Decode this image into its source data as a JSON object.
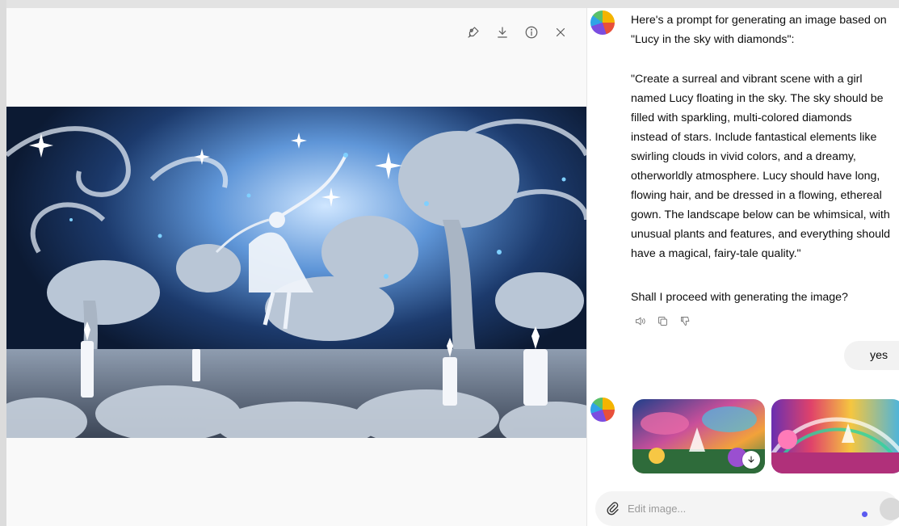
{
  "viewer": {
    "toolbar": {
      "edit_icon": "brush-icon",
      "download_icon": "download-icon",
      "info_icon": "info-icon",
      "close_icon": "close-icon"
    }
  },
  "chat": {
    "assistant_intro": [
      "Here's a prompt for generating an image based on",
      "\"Lucy in the sky with diamonds\":"
    ],
    "prompt_lines": [
      "\"Create a surreal and vibrant scene with a girl",
      "named Lucy floating in the sky. The sky should be",
      "filled with sparkling, multi-colored diamonds",
      "instead of stars. Include fantastical elements like",
      "swirling clouds in vivid colors, and a dreamy,",
      "otherworldly atmosphere. Lucy should have long,",
      "flowing hair, and be dressed in a flowing, ethereal",
      "gown. The landscape below can be whimsical, with",
      "unusual plants and features, and everything should",
      "have a magical, fairy-tale quality.\""
    ],
    "question": "Shall I proceed with generating the image?",
    "actions": [
      "read-aloud-icon",
      "copy-icon",
      "thumbs-down-icon"
    ],
    "user_reply": "yes",
    "composer": {
      "placeholder": "Edit image..."
    }
  },
  "colors": {
    "accent_dot": "#5b5bf0",
    "bubble_bg": "#f2f2f2",
    "composer_bg": "#f4f4f4"
  }
}
